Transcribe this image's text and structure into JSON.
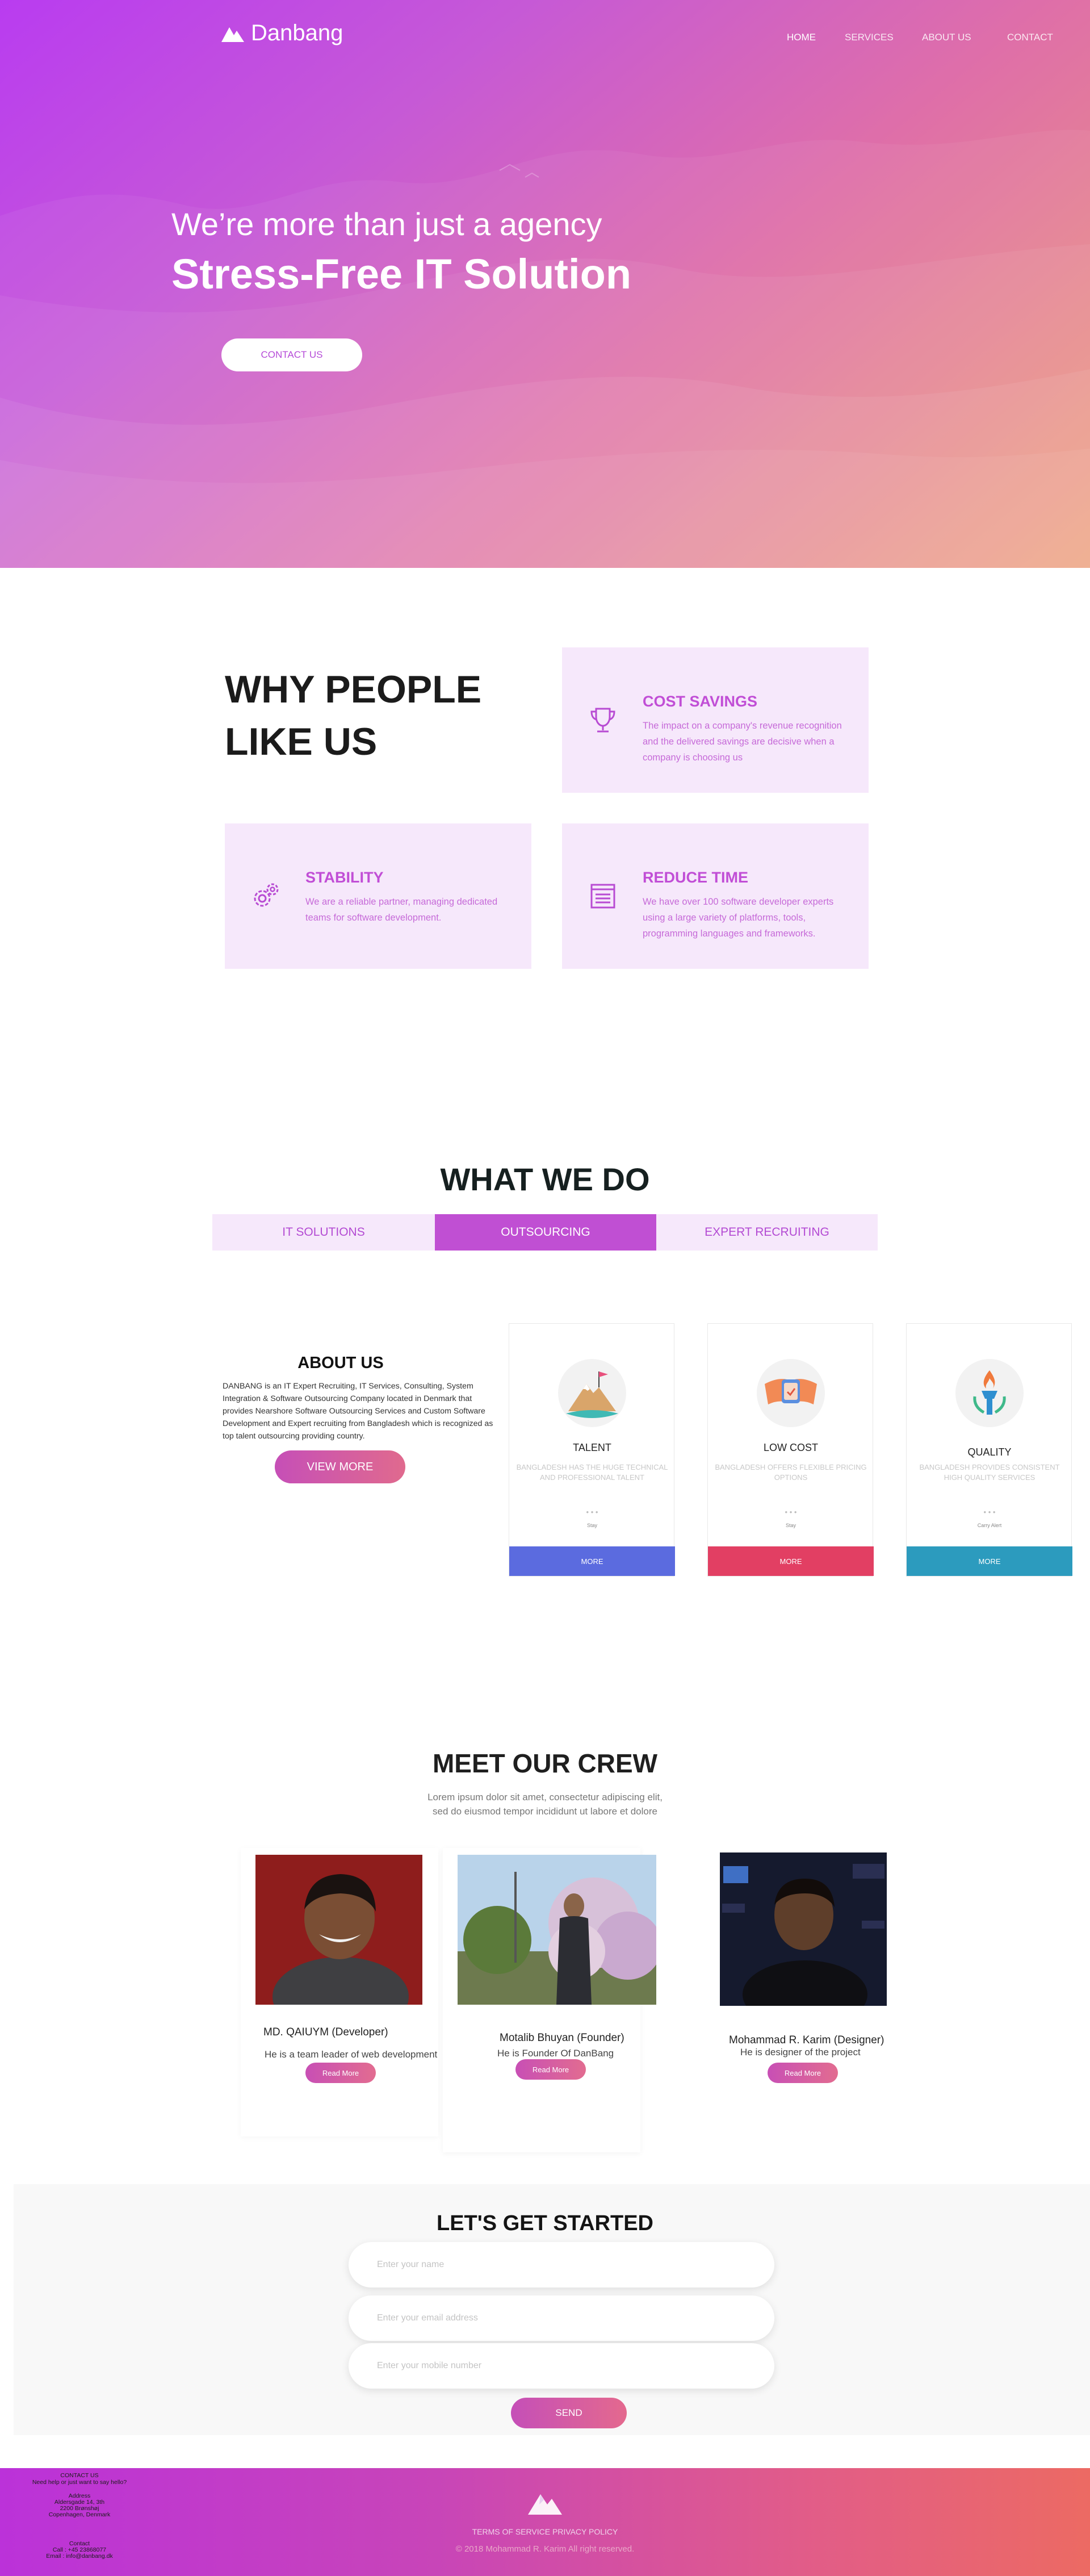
{
  "brand": {
    "name": "Danbang"
  },
  "nav": {
    "items": [
      "HOME",
      "SERVICES",
      "ABOUT US",
      "CONTACT"
    ]
  },
  "hero": {
    "subtitle": "We’re more than just a agency",
    "title": "Stress-Free IT Solution",
    "cta": "CONTACT US"
  },
  "why": {
    "title_line1": "WHY PEOPLE",
    "title_line2": "LIKE US",
    "cards": [
      {
        "title": "COST SAVINGS",
        "text": "The impact on a company's revenue recognition and the delivered savings are decisive when a company is choosing us",
        "icon": "trophy-icon"
      },
      {
        "title": "STABILITY",
        "text": "We are a reliable partner, managing dedicated teams for software development.",
        "icon": "gears-icon"
      },
      {
        "title": "REDUCE TIME",
        "text": "We have over 100 software developer experts using a large variety of platforms, tools, programming languages and frameworks.",
        "icon": "list-icon"
      }
    ]
  },
  "what_we_do": {
    "title": "WHAT WE DO",
    "tabs": [
      "IT SOLUTIONS",
      "OUTSOURCING",
      "EXPERT RECRUITING"
    ],
    "active_tab": "OUTSOURCING"
  },
  "about": {
    "title": "ABOUT US",
    "text": "DANBANG is an IT Expert Recruiting, IT Services, Consulting, System Integration & Software Outsourcing Company located in Denmark that provides Nearshore Software Outsourcing Services and Custom Software Development and Expert recruiting from Bangladesh which is recognized as top talent outsourcing providing country.",
    "button": "VIEW MORE"
  },
  "features": [
    {
      "title": "TALENT",
      "text": "BANGLADESH HAS THE HUGE TECHNICAL AND PROFESSIONAL TALENT",
      "dots": "• • •",
      "small": "Stay",
      "more": "MORE",
      "color": "#5b6bdf"
    },
    {
      "title": "LOW COST",
      "text": "BANGLADESH OFFERS FLEXIBLE PRICING OPTIONS",
      "dots": "• • •",
      "small": "Stay",
      "more": "MORE",
      "color": "#e23f63"
    },
    {
      "title": "QUALITY",
      "text": "BANGLADESH PROVIDES CONSISTENT HIGH QUALITY SERVICES",
      "dots": "• • •",
      "small": "Carry Alert",
      "more": "MORE",
      "color": "#2c9bbe"
    }
  ],
  "crew": {
    "title": "MEET OUR CREW",
    "text_line1": "Lorem ipsum dolor sit amet, consectetur adipiscing elit,",
    "text_line2": "sed do eiusmod tempor incididunt ut labore et dolore",
    "members": [
      {
        "name": "MD. QAIUYM (Developer)",
        "desc": "He is a team leader of web development",
        "button": "Read More"
      },
      {
        "name": "Motalib Bhuyan  (Founder)",
        "desc": "He is Founder Of DanBang",
        "button": "Read More"
      },
      {
        "name": "Mohammad R. Karim (Designer)",
        "desc": "He is designer of the project",
        "button": "Read More"
      }
    ]
  },
  "contact": {
    "title": "LET'S GET STARTED",
    "name_placeholder": "Enter your name",
    "email_placeholder": "Enter your email address",
    "mobile_placeholder": "Enter your mobile number",
    "send": "SEND"
  },
  "footer": {
    "contact_title": "CONTACT US",
    "contact_help": "Need help or just want to say hello?",
    "address_label": "Address",
    "address_line1": "Aldersgade 14, 3th",
    "address_line2": "2200 Brønshøj",
    "address_line3": "Copenhagen, Denmark",
    "contact_label": "Contact",
    "phone": "Call : +45 23868077",
    "email": "Email : info@danbang.dk",
    "links": "TERMS OF SERVICE PRIVACY POLICY",
    "copyright": "© 2018 Mohammad R. Karim All right reserved."
  }
}
